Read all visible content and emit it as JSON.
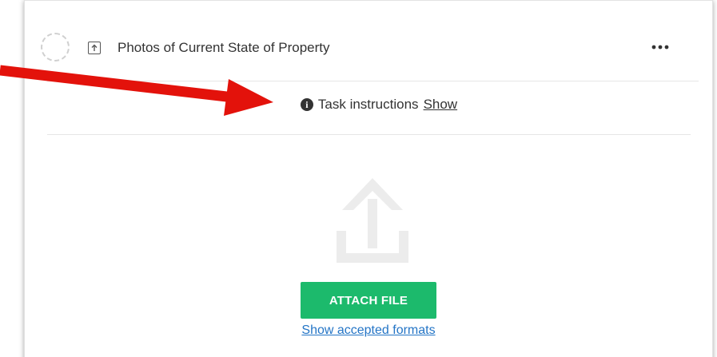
{
  "task": {
    "title": "Photos of Current State of Property",
    "more_icon": "more-horizontal-icon",
    "status_icon": "dashed-circle-icon",
    "type_icon": "upload-box-icon"
  },
  "instructions": {
    "icon": "info-icon",
    "label": "Task instructions",
    "toggle_label": "Show"
  },
  "upload": {
    "graphic_icon": "upload-tray-icon",
    "attach_label": "ATTACH FILE",
    "formats_link": "Show accepted formats"
  },
  "colors": {
    "accent_green": "#1cba6c",
    "link_blue": "#2475c6",
    "annotation_arrow": "#e3120b",
    "text": "#333333"
  }
}
